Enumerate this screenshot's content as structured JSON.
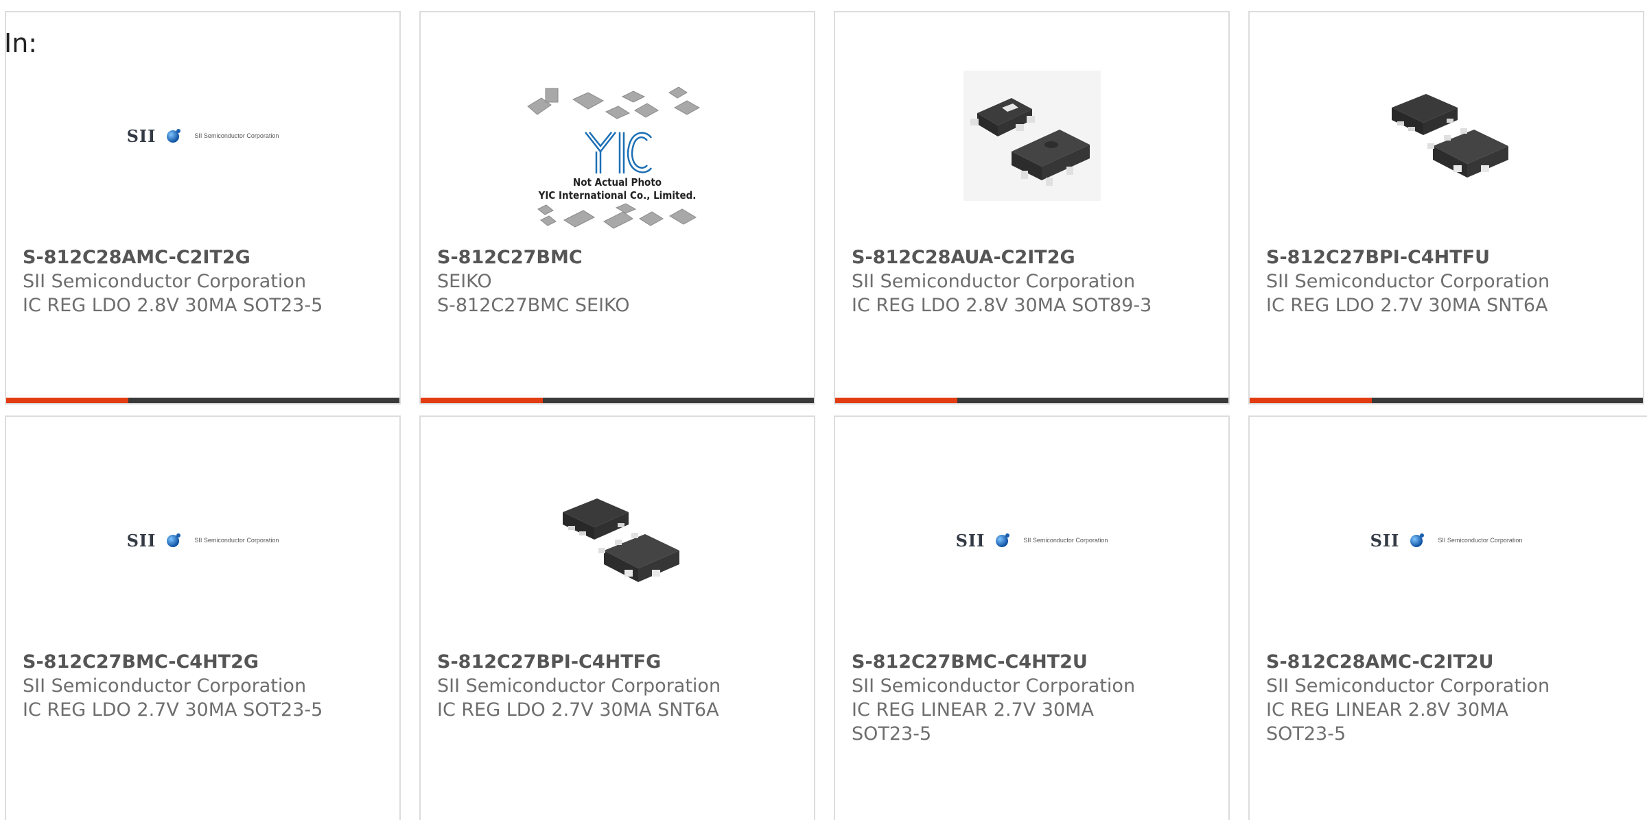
{
  "header": {
    "in_label": "In:"
  },
  "colors": {
    "accent": "#e23d12",
    "bar_dark": "#3a3a3a",
    "card_border": "#dcdcdc",
    "text_gray": "#6e6e6e"
  },
  "products": [
    {
      "part_number": "S-812C28AMC-C2IT2G",
      "manufacturer": "SII Semiconductor Corporation",
      "description": "IC REG LDO 2.8V 30MA SOT23-5",
      "image": "sii-logo",
      "logo_text": "SII",
      "logo_sub": "SII Semiconductor Corporation",
      "progress": 0.31
    },
    {
      "part_number": "S-812C27BMC",
      "manufacturer": "SEIKO",
      "description": "S-812C27BMC SEIKO",
      "image": "yic-placeholder",
      "logo_text": "YIC",
      "note_line1": "Not Actual Photo",
      "note_line2": "YIC International Co., Limited.",
      "progress": 0.31
    },
    {
      "part_number": "S-812C28AUA-C2IT2G",
      "manufacturer": "SII Semiconductor Corporation",
      "description": "IC REG LDO 2.8V 30MA SOT89-3",
      "image": "sot89-package-photo",
      "progress": 0.31
    },
    {
      "part_number": "S-812C27BPI-C4HTFU",
      "manufacturer": "SII Semiconductor Corporation",
      "description": "IC REG LDO 2.7V 30MA SNT6A",
      "image": "snt6a-package-photo",
      "progress": 0.31
    },
    {
      "part_number": "S-812C27BMC-C4HT2G",
      "manufacturer": "SII Semiconductor Corporation",
      "description": "IC REG LDO 2.7V 30MA SOT23-5",
      "image": "sii-logo",
      "logo_text": "SII",
      "logo_sub": "SII Semiconductor Corporation"
    },
    {
      "part_number": "S-812C27BPI-C4HTFG",
      "manufacturer": "SII Semiconductor Corporation",
      "description": "IC REG LDO 2.7V 30MA SNT6A",
      "image": "snt6a-package-photo"
    },
    {
      "part_number": "S-812C27BMC-C4HT2U",
      "manufacturer": "SII Semiconductor Corporation",
      "description": "IC REG LINEAR 2.7V 30MA SOT23-5",
      "image": "sii-logo",
      "logo_text": "SII",
      "logo_sub": "SII Semiconductor Corporation"
    },
    {
      "part_number": "S-812C28AMC-C2IT2U",
      "manufacturer": "SII Semiconductor Corporation",
      "description": "IC REG LINEAR 2.8V 30MA SOT23-5",
      "image": "sii-logo",
      "logo_text": "SII",
      "logo_sub": "SII Semiconductor Corporation"
    }
  ]
}
